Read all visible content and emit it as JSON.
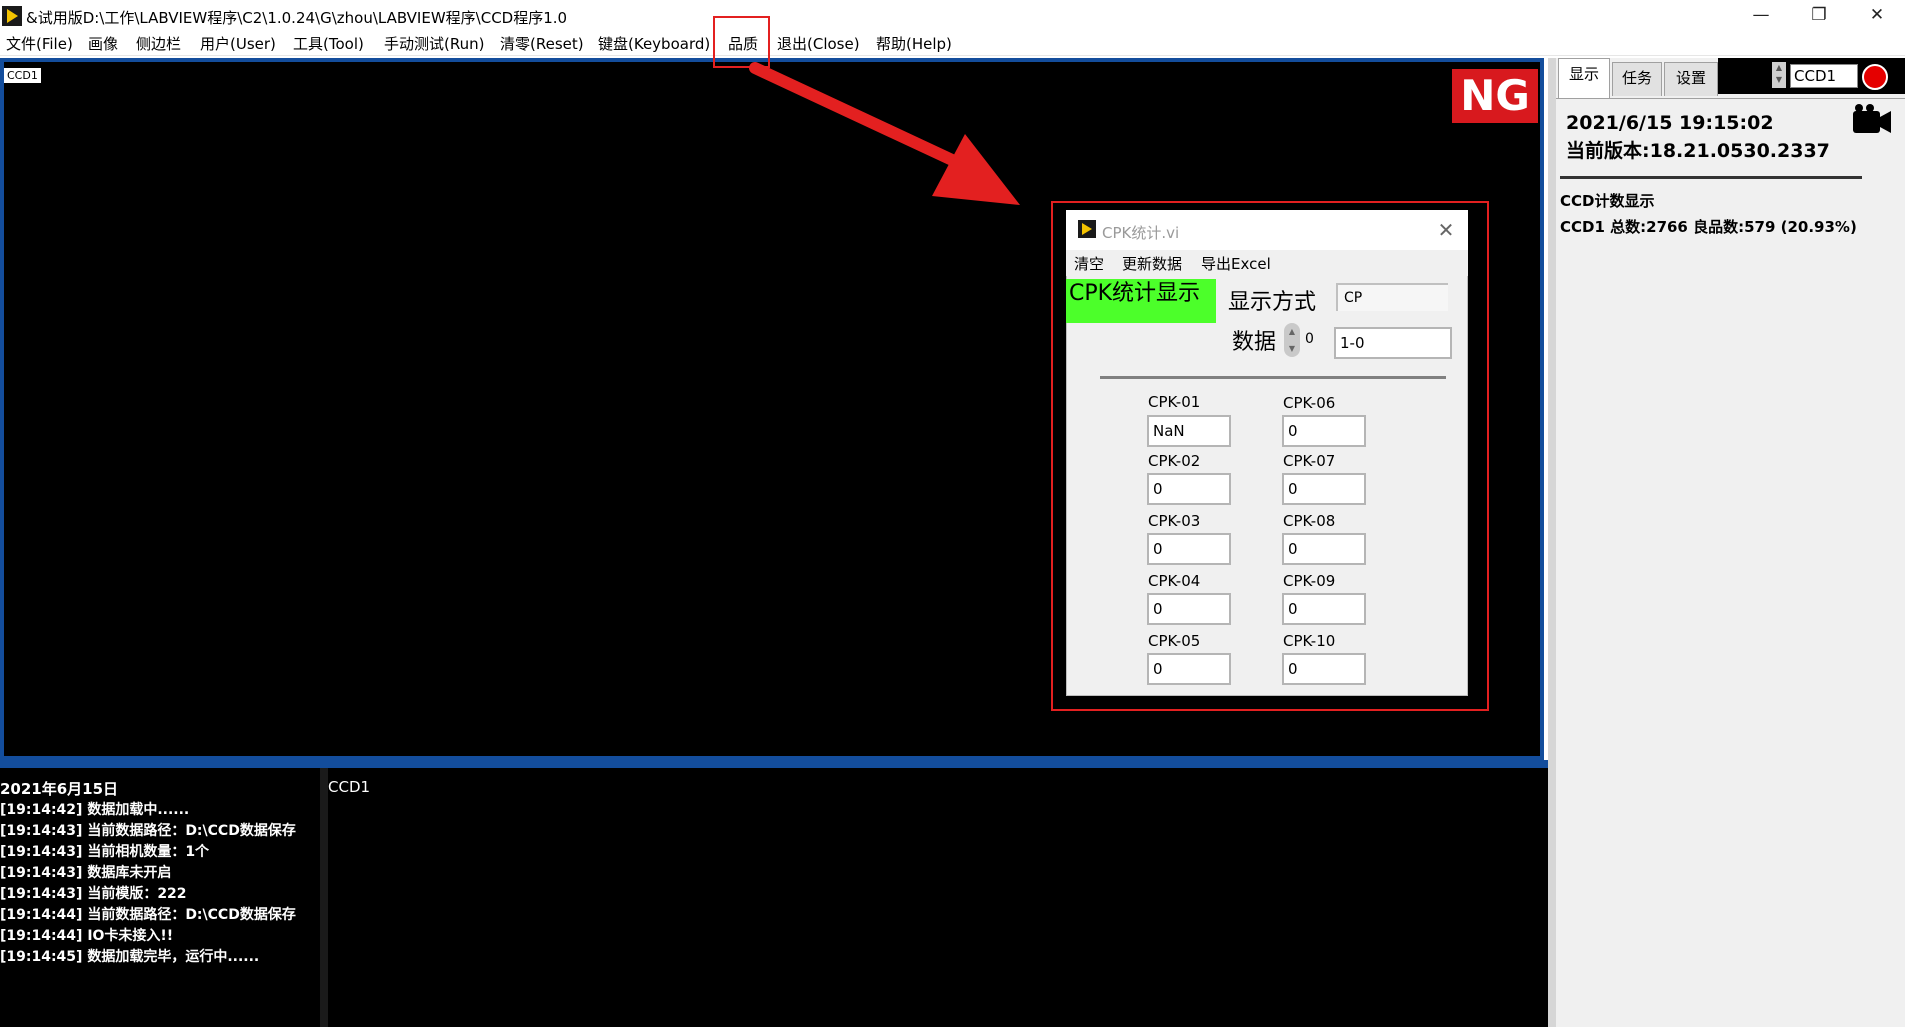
{
  "window": {
    "title": "&试用版D:\\工作\\LABVIEW程序\\C2\\1.0.24\\G\\zhou\\LABVIEW程序\\CCD程序1.0",
    "minimize_glyph": "—",
    "restore_glyph": "❐",
    "close_glyph": "✕"
  },
  "menu": [
    {
      "label": "文件(File)"
    },
    {
      "label": "画像"
    },
    {
      "label": "侧边栏"
    },
    {
      "label": "用户(User)"
    },
    {
      "label": "工具(Tool)"
    },
    {
      "label": "手动测试(Run)"
    },
    {
      "label": "清零(Reset)"
    },
    {
      "label": "键盘(Keyboard)"
    },
    {
      "label": "品质"
    },
    {
      "label": "退出(Close)"
    },
    {
      "label": "帮助(Help)"
    }
  ],
  "main_display": {
    "camera_tag": "CCD1",
    "result_badge": "NG"
  },
  "log": {
    "date": "2021年6月15日",
    "lines": [
      "[19:14:42]  数据加载中......",
      "[19:14:43]  当前数据路径：D:\\CCD数据保存",
      "[19:14:43]  当前相机数量：1个",
      "[19:14:43]  数据库未开启",
      "[19:14:43]  当前模版：222",
      "[19:14:44]  当前数据路径：D:\\CCD数据保存",
      "[19:14:44]  IO卡未接入!!",
      "[19:14:45]  数据加载完毕，运行中......"
    ]
  },
  "ccd_output": {
    "label": "CCD1"
  },
  "right_panel": {
    "tabs": [
      "显示",
      "任务",
      "设置"
    ],
    "camera_select": "CCD1",
    "record_color": "#e50000",
    "datetime": "2021/6/15 19:15:02",
    "version": "当前版本:18.21.0530.2337",
    "count_title": "CCD计数显示",
    "count_line": "CCD1 总数:2766   良品数:579 (20.93%)"
  },
  "cpk_window": {
    "title": "CPK统计.vi",
    "close_glyph": "✕",
    "menu": [
      "清空",
      "更新数据",
      "导出Excel"
    ],
    "heading": "CPK统计显示",
    "display_mode_label": "显示方式",
    "display_mode_value": "CP",
    "data_label": "数据",
    "data_index": "0",
    "data_value": "1-0",
    "fields": [
      {
        "label": "CPK-01",
        "value": "NaN"
      },
      {
        "label": "CPK-02",
        "value": "0"
      },
      {
        "label": "CPK-03",
        "value": "0"
      },
      {
        "label": "CPK-04",
        "value": "0"
      },
      {
        "label": "CPK-05",
        "value": "0"
      },
      {
        "label": "CPK-06",
        "value": "0"
      },
      {
        "label": "CPK-07",
        "value": "0"
      },
      {
        "label": "CPK-08",
        "value": "0"
      },
      {
        "label": "CPK-09",
        "value": "0"
      },
      {
        "label": "CPK-10",
        "value": "0"
      }
    ]
  },
  "colors": {
    "accent_blue": "#134d9c",
    "ng_red": "#d8191e",
    "annotation_red": "#e32020",
    "cpk_heading_green": "#4cff2a"
  }
}
